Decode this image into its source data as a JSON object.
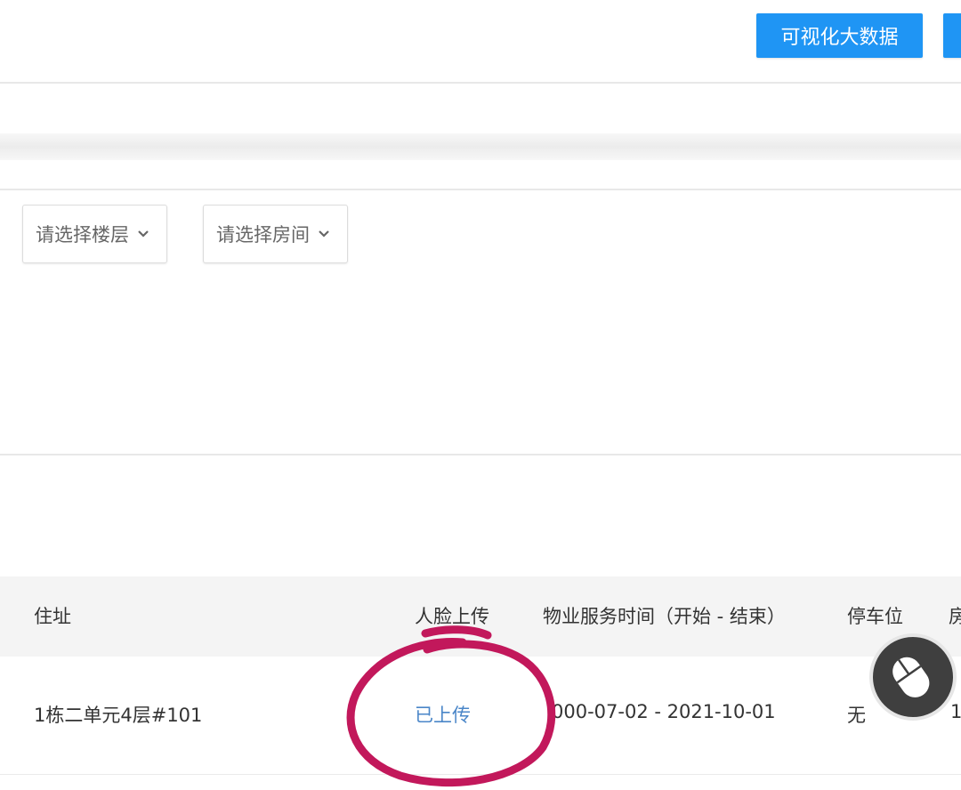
{
  "toolbar": {
    "visualize_label": "可视化大数据"
  },
  "filters": {
    "floor_placeholder": "请选择楼层",
    "room_placeholder": "请选择房间"
  },
  "table": {
    "headers": {
      "address": "住址",
      "face_upload": "人脸上传",
      "service_time": "物业服务时间（开始 - 结束）",
      "parking": "停车位",
      "next_col_partial": "房"
    },
    "rows": [
      {
        "address": "1栋二单元4层#101",
        "face_upload": "已上传",
        "service_time": "000-07-02 - 2021-10-01",
        "parking": "无",
        "next_col_partial": "1"
      }
    ]
  },
  "colors": {
    "primary": "#1f95f4",
    "link": "#4a86c8",
    "annotation": "#c2185b"
  },
  "icons": {
    "dropdown": "chevron-down-icon",
    "mouse": "mouse-icon"
  }
}
